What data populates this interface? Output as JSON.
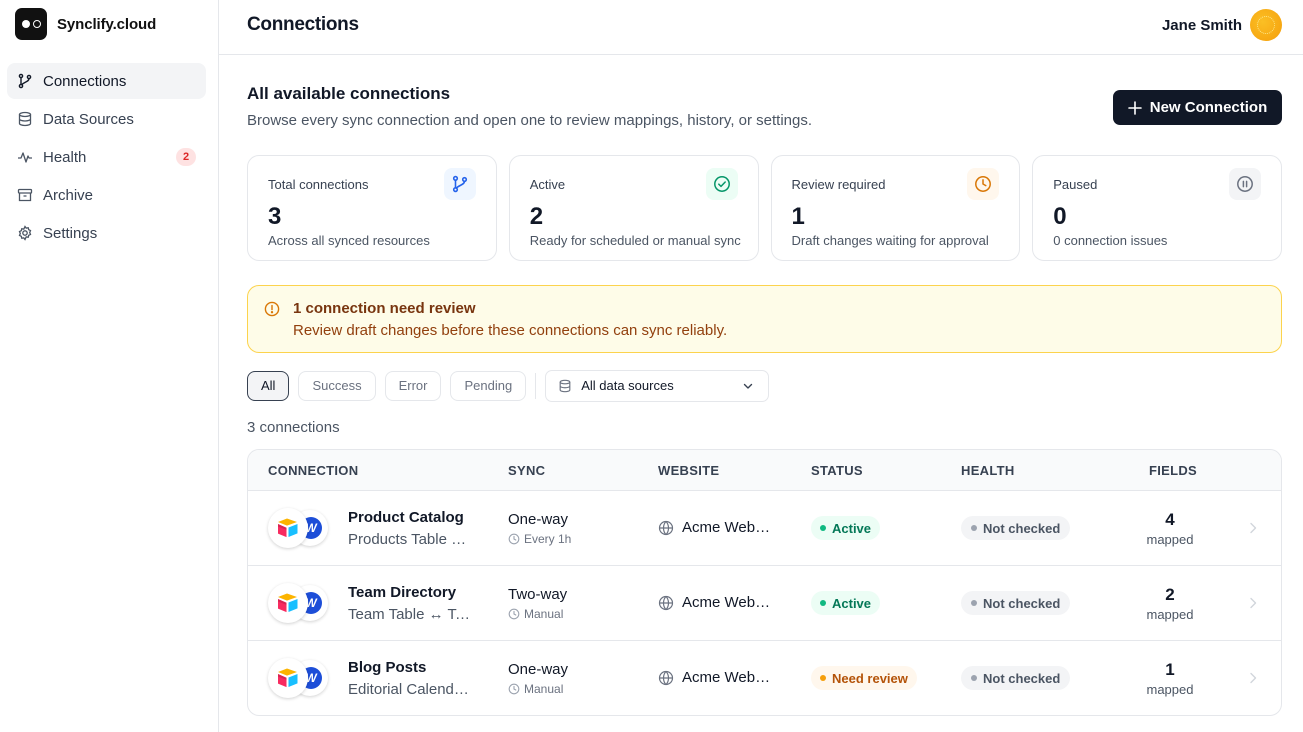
{
  "app": {
    "name": "Synclify.cloud"
  },
  "sidebar": {
    "items": [
      {
        "label": "Connections",
        "icon": "branch-icon",
        "active": true
      },
      {
        "label": "Data Sources",
        "icon": "database-icon"
      },
      {
        "label": "Health",
        "icon": "activity-icon",
        "badge": "2"
      },
      {
        "label": "Archive",
        "icon": "archive-icon"
      },
      {
        "label": "Settings",
        "icon": "gear-icon"
      }
    ]
  },
  "header": {
    "title": "Connections",
    "user_name": "Jane Smith"
  },
  "main": {
    "section_title": "All available connections",
    "section_subtitle": "Browse every sync connection and open one to review mappings, history, or settings.",
    "new_button_label": "New Connection"
  },
  "stats": [
    {
      "label": "Total connections",
      "value": "3",
      "desc": "Across all synced resources",
      "icon": "branch-icon",
      "color": "#2563eb"
    },
    {
      "label": "Active",
      "value": "2",
      "desc": "Ready for scheduled or manual sync",
      "icon": "check-circle-icon",
      "color": "#059669"
    },
    {
      "label": "Review required",
      "value": "1",
      "desc": "Draft changes waiting for approval",
      "icon": "clock-icon",
      "color": "#d97706"
    },
    {
      "label": "Paused",
      "value": "0",
      "desc": "0 connection issues",
      "icon": "pause-circle-icon",
      "color": "#6b7280"
    }
  ],
  "alert": {
    "title": "1 connection need review",
    "text": "Review draft changes before these connections can sync reliably."
  },
  "filters": {
    "chips": [
      "All",
      "Success",
      "Error",
      "Pending"
    ],
    "active": "All",
    "source_select": "All data sources"
  },
  "results_count": "3 connections",
  "table": {
    "headers": [
      "CONNECTION",
      "SYNC",
      "WEBSITE",
      "STATUS",
      "HEALTH",
      "FIELDS"
    ],
    "rows": [
      {
        "name": "Product Catalog",
        "sub": "Products Table ↔ Products",
        "sync": "One-way",
        "freq": "Every 1h",
        "website": "Acme Webflow Site",
        "status": "Active",
        "status_tone": "green",
        "health": "Not checked",
        "fields": "4",
        "fields_label": "mapped"
      },
      {
        "name": "Team Directory",
        "sub": "Team Table ↔ Team Members",
        "sync": "Two-way",
        "freq": "Manual",
        "website": "Acme Webflow Site",
        "status": "Active",
        "status_tone": "green",
        "health": "Not checked",
        "fields": "2",
        "fields_label": "mapped"
      },
      {
        "name": "Blog Posts",
        "sub": "Editorial Calendar ↔ Blog Posts",
        "sync": "One-way",
        "freq": "Manual",
        "website": "Acme Webflow Site",
        "status": "Need review",
        "status_tone": "amber",
        "health": "Not checked",
        "fields": "1",
        "fields_label": "mapped"
      }
    ]
  }
}
